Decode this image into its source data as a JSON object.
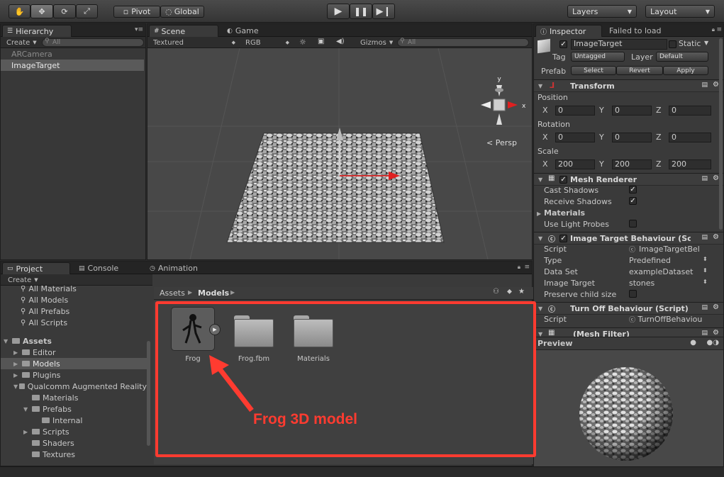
{
  "toolbar": {
    "pivot_label": "Pivot",
    "global_label": "Global",
    "layers_label": "Layers",
    "layout_label": "Layout"
  },
  "hierarchy": {
    "tab_label": "Hierarchy",
    "create_label": "Create",
    "search_placeholder": "All",
    "items": [
      "ARCamera",
      "ImageTarget"
    ]
  },
  "scene": {
    "tabs": [
      "Scene",
      "Game"
    ],
    "textured_label": "Textured",
    "rgb_label": "RGB",
    "gizmos_label": "Gizmos",
    "search_placeholder": "All",
    "persp_label": "Persp",
    "axis_x": "x",
    "axis_y": "y"
  },
  "project": {
    "tabs": [
      "Project",
      "Console",
      "Animation"
    ],
    "create_label": "Create",
    "favorites": [
      "All Materials",
      "All Models",
      "All Prefabs",
      "All Scripts"
    ],
    "tree": [
      {
        "label": "Assets",
        "level": 0,
        "bold": true
      },
      {
        "label": "Editor",
        "level": 1
      },
      {
        "label": "Models",
        "level": 1,
        "selected": true
      },
      {
        "label": "Plugins",
        "level": 1
      },
      {
        "label": "Qualcomm Augmented Reality",
        "level": 1
      },
      {
        "label": "Materials",
        "level": 2
      },
      {
        "label": "Prefabs",
        "level": 2
      },
      {
        "label": "Internal",
        "level": 3
      },
      {
        "label": "Scripts",
        "level": 2
      },
      {
        "label": "Shaders",
        "level": 2
      },
      {
        "label": "Textures",
        "level": 2
      }
    ],
    "breadcrumb": [
      "Assets",
      "Models"
    ],
    "assets": [
      "Frog",
      "Frog.fbm",
      "Materials"
    ],
    "annotation": "Frog 3D model",
    "annotation_color": "#ff3b30"
  },
  "inspector": {
    "tabs": [
      "Inspector",
      "Failed to load"
    ],
    "object_name": "ImageTarget",
    "static_label": "Static",
    "tag_label": "Tag",
    "tag_value": "Untagged",
    "layer_label": "Layer",
    "layer_value": "Default",
    "prefab_label": "Prefab",
    "prefab_buttons": [
      "Select",
      "Revert",
      "Apply"
    ],
    "transform": {
      "title": "Transform",
      "position_label": "Position",
      "rotation_label": "Rotation",
      "scale_label": "Scale",
      "axes": [
        "X",
        "Y",
        "Z"
      ],
      "position": [
        "0",
        "0",
        "0"
      ],
      "rotation": [
        "0",
        "0",
        "0"
      ],
      "scale": [
        "200",
        "200",
        "200"
      ]
    },
    "mesh_renderer": {
      "title": "Mesh Renderer",
      "cast_shadows_label": "Cast Shadows",
      "receive_shadows_label": "Receive Shadows",
      "materials_label": "Materials",
      "light_probes_label": "Use Light Probes"
    },
    "image_target": {
      "title": "Image Target Behaviour (Scri",
      "rows": [
        {
          "label": "Script",
          "value": "ImageTargetBel"
        },
        {
          "label": "Type",
          "value": "Predefined"
        },
        {
          "label": "Data Set",
          "value": "exampleDataset"
        },
        {
          "label": "Image Target",
          "value": "stones"
        },
        {
          "label": "Preserve child size",
          "value": ""
        }
      ]
    },
    "turn_off": {
      "title": "Turn Off Behaviour (Script)",
      "script_label": "Script",
      "script_value": "TurnOffBehaviou"
    },
    "mesh_filter_title": "(Mesh Filter)",
    "preview_label": "Preview"
  },
  "icons": [
    "hand-icon",
    "move-icon",
    "rotate-icon",
    "scale-icon",
    "play-icon",
    "pause-icon",
    "step-icon",
    "sun-icon",
    "image-icon",
    "audio-icon",
    "gear-icon",
    "lock-icon"
  ]
}
